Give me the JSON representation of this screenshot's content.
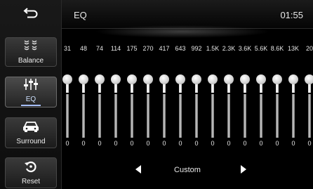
{
  "header": {
    "title": "EQ",
    "clock": "01:55"
  },
  "sidebar": {
    "back_icon": "back-arrow-icon",
    "items": [
      {
        "label": "Balance",
        "icon": "balance-speakers-icon",
        "active": false
      },
      {
        "label": "EQ",
        "icon": "equalizer-sliders-icon",
        "active": true
      },
      {
        "label": "Surround",
        "icon": "car-icon",
        "active": false
      },
      {
        "label": "Reset",
        "icon": "reset-icon",
        "active": false
      }
    ]
  },
  "eq": {
    "frequencies": [
      "31",
      "48",
      "74",
      "114",
      "175",
      "270",
      "417",
      "643",
      "992",
      "1.5K",
      "2.3K",
      "3.6K",
      "5.6K",
      "8.6K",
      "13K",
      "20"
    ],
    "gains": [
      "0",
      "0",
      "0",
      "0",
      "0",
      "0",
      "0",
      "0",
      "0",
      "0",
      "0",
      "0",
      "0",
      "0",
      "0",
      "0"
    ]
  },
  "preset": {
    "name": "Custom",
    "prev_icon": "triangle-left-icon",
    "next_icon": "triangle-right-icon"
  },
  "colors": {
    "background": "#000000",
    "active_accent": "#a7bfff",
    "text": "#ffffff"
  }
}
